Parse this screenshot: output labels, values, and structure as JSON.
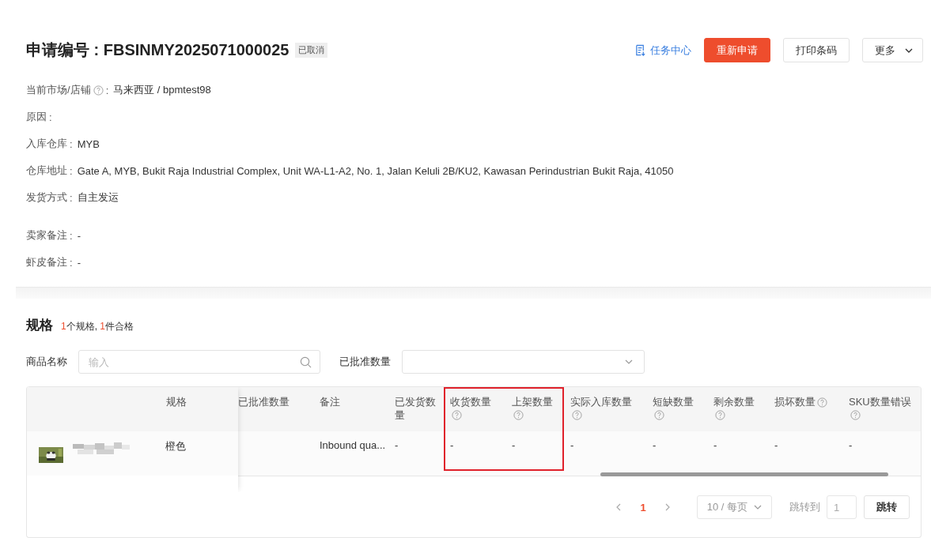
{
  "header": {
    "label": "申请编号 : ",
    "number": "FBSINMY2025071000025",
    "status": "已取消"
  },
  "actions": {
    "task_center": "任务中心",
    "reapply": "重新申请",
    "print": "打印条码",
    "more": "更多"
  },
  "info": [
    {
      "label": "当前市场/店铺",
      "help": true,
      "colon": ":",
      "value": "马来西亚 / bpmtest98"
    },
    {
      "label": "原因",
      "help": false,
      "colon": ":"
    },
    {
      "label": "入库仓库",
      "help": false,
      "colon": ":",
      "value": "MYB"
    },
    {
      "label": "仓库地址",
      "help": false,
      "colon": ":",
      "value": "Gate A, MYB, Bukit Raja Industrial Complex, Unit WA-L1-A2, No. 1, Jalan Keluli 2B/KU2, Kawasan Perindustrian Bukit Raja, 41050"
    },
    {
      "label": "发货方式",
      "help": false,
      "colon": ":",
      "value": "自主发运"
    }
  ],
  "notes": [
    {
      "label": "卖家备注",
      "colon": ":",
      "value": "-"
    },
    {
      "label": "虾皮备注",
      "colon": ":",
      "value": "-"
    }
  ],
  "specs": {
    "title": "规格",
    "summary": "**1**个规格, **1**件合格"
  },
  "filters": {
    "name_label": "商品名称",
    "name_placeholder": "输入",
    "qty_label": "已批准数量"
  },
  "table": {
    "spec_header": "规格",
    "columns": [
      {
        "label": "已批准数量",
        "help": false,
        "highlighted": false
      },
      {
        "label": "备注",
        "help": false,
        "highlighted": false
      },
      {
        "label": "已发货数量",
        "help": false,
        "highlighted": false
      },
      {
        "label": "收货数量",
        "help": true,
        "highlighted": true
      },
      {
        "label": "上架数量",
        "help": true,
        "highlighted": true
      },
      {
        "label": "实际入库数量",
        "help": true,
        "highlighted": false
      },
      {
        "label": "短缺数量",
        "help": true,
        "highlighted": false
      },
      {
        "label": "剩余数量",
        "help": true,
        "highlighted": false
      },
      {
        "label": "损坏数量",
        "help": true,
        "highlighted": false
      },
      {
        "label": "SKU数量错误",
        "help": true,
        "highlighted": false
      }
    ],
    "rows": [
      {
        "spec": "橙色",
        "cells": [
          null,
          "Inbound qua...",
          "-",
          "-",
          "-",
          "-",
          "-",
          "-",
          "-",
          "-"
        ]
      }
    ]
  },
  "pagination": {
    "pages": [
      {
        "label": "1",
        "selected": true
      }
    ],
    "page_size": "10 / 每页",
    "jump_label": "跳转到",
    "jump_value": "1",
    "jump_button": "跳转"
  }
}
